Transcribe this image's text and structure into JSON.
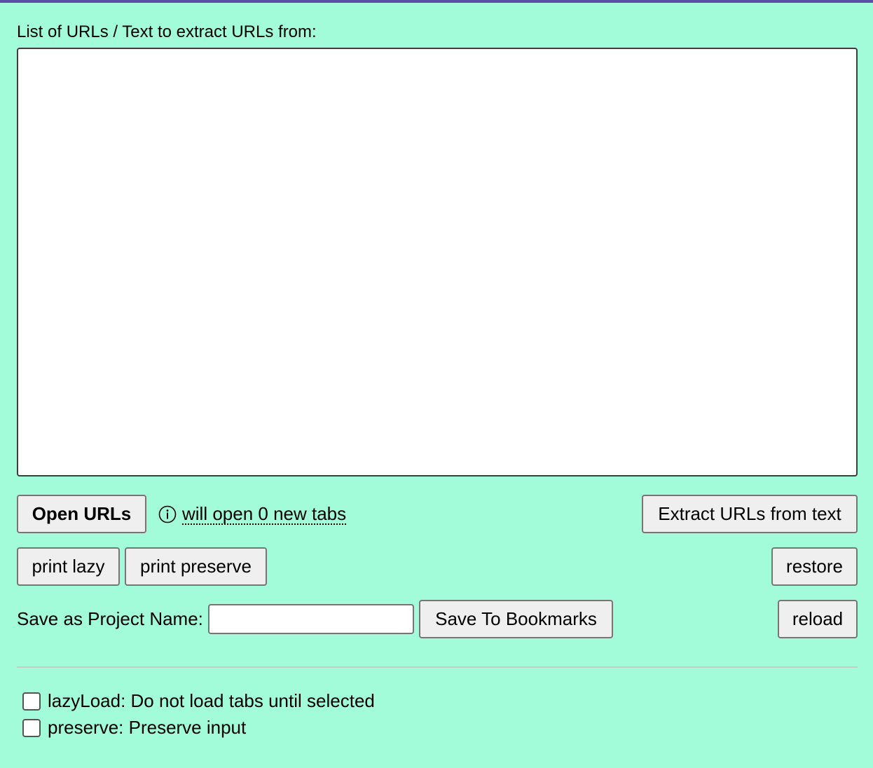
{
  "url_input": {
    "label": "List of URLs / Text to extract URLs from:",
    "value": "",
    "placeholder": ""
  },
  "actions": {
    "open_urls_label": "Open URLs",
    "tab_count_text": "will open 0 new tabs",
    "extract_label": "Extract URLs from text",
    "print_lazy_label": "print lazy",
    "print_preserve_label": "print preserve",
    "restore_label": "restore",
    "save_bookmarks_label": "Save To Bookmarks",
    "reload_label": "reload"
  },
  "project": {
    "label": "Save as Project Name:",
    "value": ""
  },
  "options": {
    "lazy_load_label": "lazyLoad: Do not load tabs until selected",
    "lazy_load_checked": false,
    "preserve_label": "preserve: Preserve input",
    "preserve_checked": false
  },
  "theme": {
    "background": "#a3fcd9",
    "top_bar": "#5b4ea6",
    "button_bg": "#efefef",
    "button_border": "#767676"
  },
  "icons": {
    "info": "info-circle-icon"
  }
}
